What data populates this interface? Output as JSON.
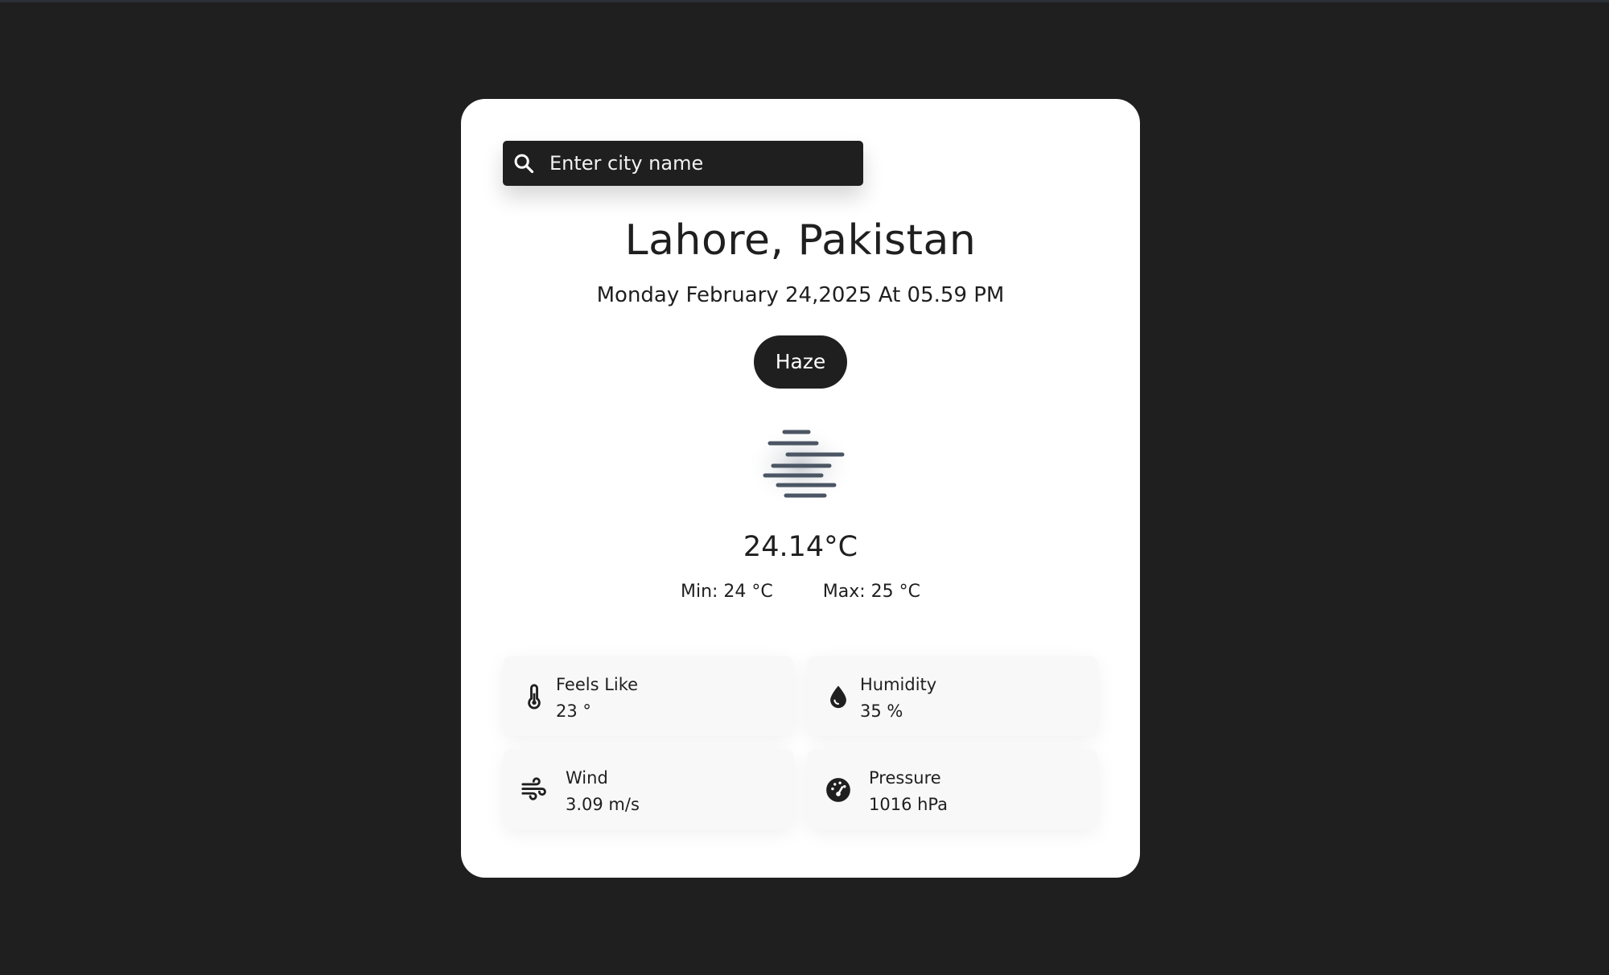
{
  "search": {
    "placeholder": "Enter city name",
    "icon": "search-icon"
  },
  "location": {
    "city": "Lahore, Pakistan",
    "datetime": "Monday February 24,2025 At 05.59 PM"
  },
  "condition": {
    "label": "Haze",
    "icon": "haze-icon"
  },
  "temperature": {
    "current": "24.14°C",
    "min": "Min: 24 °C",
    "max": "Max: 25 °C"
  },
  "stats": {
    "feels_like": {
      "label": "Feels Like",
      "value": "23 °",
      "icon": "thermometer-icon"
    },
    "humidity": {
      "label": "Humidity",
      "value": "35 %",
      "icon": "droplet-icon"
    },
    "wind": {
      "label": "Wind",
      "value": "3.09 m/s",
      "icon": "wind-icon"
    },
    "pressure": {
      "label": "Pressure",
      "value": "1016 hPa",
      "icon": "gauge-icon"
    }
  },
  "colors": {
    "page_background": "#1f1f1f",
    "card_background": "#ffffff",
    "accent_dark": "#1f1f1f",
    "haze_icon": "#4b5563"
  }
}
